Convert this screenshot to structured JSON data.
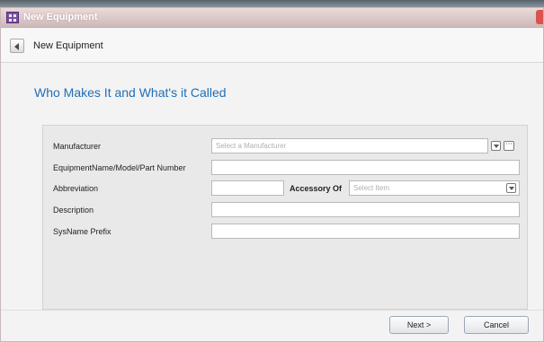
{
  "window": {
    "title": "New Equipment"
  },
  "header": {
    "title": "New Equipment"
  },
  "section": {
    "title": "Who Makes It and What's it Called"
  },
  "form": {
    "manufacturer_label": "Manufacturer",
    "manufacturer_placeholder": "Select a Manufacturer",
    "more_label": "···",
    "equipment_name_label": "EquipmentName/Model/Part Number",
    "abbreviation_label": "Abbreviation",
    "accessory_of_label": "Accessory Of",
    "accessory_of_placeholder": "Select Item",
    "description_label": "Description",
    "sysname_prefix_label": "SysName Prefix"
  },
  "footer": {
    "next_label": "Next >",
    "cancel_label": "Cancel"
  }
}
